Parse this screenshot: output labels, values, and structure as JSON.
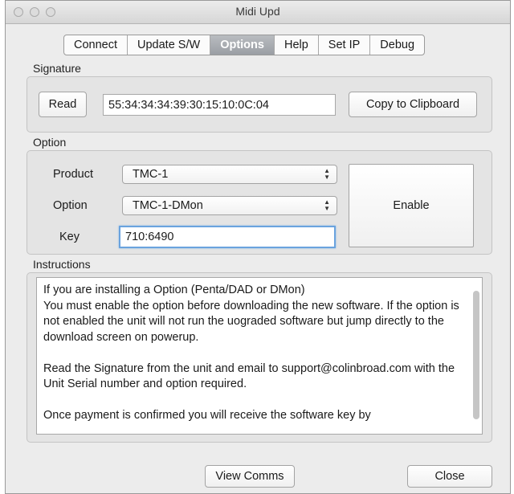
{
  "window": {
    "title": "Midi Upd"
  },
  "tabs": [
    {
      "label": "Connect"
    },
    {
      "label": "Update S/W"
    },
    {
      "label": "Options"
    },
    {
      "label": "Help"
    },
    {
      "label": "Set IP"
    },
    {
      "label": "Debug"
    }
  ],
  "active_tab": "Options",
  "signature": {
    "group_label": "Signature",
    "read_button": "Read",
    "value": "55:34:34:34:39:30:15:10:0C:04",
    "copy_button": "Copy to Clipboard"
  },
  "option": {
    "group_label": "Option",
    "product_label": "Product",
    "product_value": "TMC-1",
    "option_label": "Option",
    "option_value": "TMC-1-DMon",
    "key_label": "Key",
    "key_value": "710:6490",
    "enable_button": "Enable"
  },
  "instructions": {
    "group_label": "Instructions",
    "text": "If you are installing a Option (Penta/DAD or DMon)\nYou must enable the option before downloading the new software. If the option is not enabled the unit will not run the uograded software but jump directly to the download screen on powerup.\n\nRead the Signature from the unit and email to support@colinbroad.com with the Unit Serial number and option required.\n\nOnce payment is confirmed you will receive the software key by"
  },
  "footer": {
    "view_comms_button": "View Comms",
    "close_button": "Close"
  }
}
